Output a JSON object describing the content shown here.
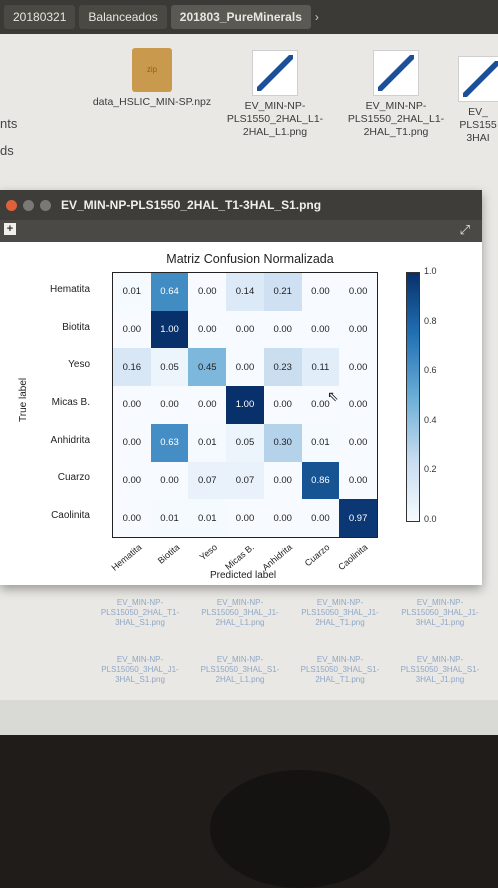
{
  "breadcrumbs": [
    "20180321",
    "Balanceados",
    "201803_PureMinerals"
  ],
  "sidebar_fragments": [
    "nts",
    "ds"
  ],
  "files": [
    {
      "name": "data_HSLIC_MIN-SP.npz",
      "kind": "zip"
    },
    {
      "name": "EV_MIN-NP-PLS1550_2HAL_L1-2HAL_L1.png",
      "kind": "png"
    },
    {
      "name": "EV_MIN-NP-PLS1550_2HAL_L1-2HAL_T1.png",
      "kind": "png"
    },
    {
      "name": "EV_ PLS155 3HAI",
      "kind": "png"
    }
  ],
  "zip_badge": "zip",
  "viewer": {
    "title": "EV_MIN-NP-PLS1550_2HAL_T1-3HAL_S1.png",
    "menu_icon": "menu-icon",
    "expand_icon": "expand-icon"
  },
  "bottom_files": [
    "EV_MIN-NP-PLS15050_2HAL_T1-3HAL_S1.png",
    "EV_MIN-NP-PLS15050_3HAL_J1-2HAL_L1.png",
    "EV_MIN-NP-PLS15050_3HAL_J1-2HAL_T1.png",
    "EV_MIN-NP-PLS15050_3HAL_J1-3HAL_J1.png",
    "EV_MIN-NP-PLS15050_3HAL_J1-3HAL_S1.png",
    "EV_MIN-NP-PLS15050_3HAL_S1-2HAL_L1.png",
    "EV_MIN-NP-PLS15050_3HAL_S1-2HAL_T1.png",
    "EV_MIN-NP-PLS15050_3HAL_S1-3HAL_J1.png"
  ],
  "chart_data": {
    "type": "heatmap",
    "title": "Matriz Confusion Normalizada",
    "xlabel": "Predicted label",
    "ylabel": "True label",
    "labels": [
      "Hematita",
      "Biotita",
      "Yeso",
      "Micas B.",
      "Anhidrita",
      "Cuarzo",
      "Caolinita"
    ],
    "matrix": [
      [
        0.01,
        0.64,
        0.0,
        0.14,
        0.21,
        0.0,
        0.0
      ],
      [
        0.0,
        1.0,
        0.0,
        0.0,
        0.0,
        0.0,
        0.0
      ],
      [
        0.16,
        0.05,
        0.45,
        0.0,
        0.23,
        0.11,
        0.0
      ],
      [
        0.0,
        0.0,
        0.0,
        1.0,
        0.0,
        0.0,
        0.0
      ],
      [
        0.0,
        0.63,
        0.01,
        0.05,
        0.3,
        0.01,
        0.0
      ],
      [
        0.0,
        0.0,
        0.07,
        0.07,
        0.0,
        0.86,
        0.0
      ],
      [
        0.0,
        0.01,
        0.01,
        0.0,
        0.0,
        0.0,
        0.97
      ]
    ],
    "colorbar_ticks": [
      "1.0",
      "0.8",
      "0.6",
      "0.4",
      "0.2",
      "0.0"
    ],
    "colormap": "Blues",
    "vmin": 0.0,
    "vmax": 1.0
  }
}
